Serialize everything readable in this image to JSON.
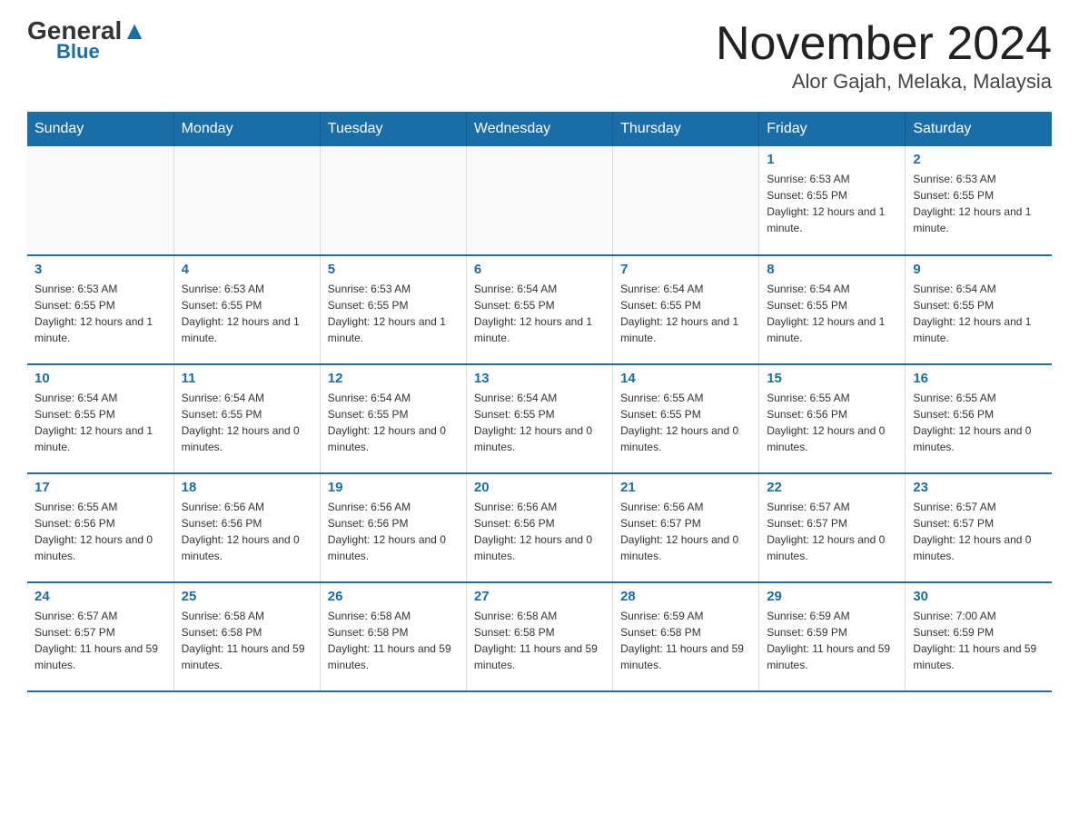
{
  "header": {
    "logo_general": "General",
    "logo_blue": "Blue",
    "month_title": "November 2024",
    "location": "Alor Gajah, Melaka, Malaysia"
  },
  "days_of_week": [
    "Sunday",
    "Monday",
    "Tuesday",
    "Wednesday",
    "Thursday",
    "Friday",
    "Saturday"
  ],
  "weeks": [
    [
      {
        "day": "",
        "info": ""
      },
      {
        "day": "",
        "info": ""
      },
      {
        "day": "",
        "info": ""
      },
      {
        "day": "",
        "info": ""
      },
      {
        "day": "",
        "info": ""
      },
      {
        "day": "1",
        "info": "Sunrise: 6:53 AM\nSunset: 6:55 PM\nDaylight: 12 hours and 1 minute."
      },
      {
        "day": "2",
        "info": "Sunrise: 6:53 AM\nSunset: 6:55 PM\nDaylight: 12 hours and 1 minute."
      }
    ],
    [
      {
        "day": "3",
        "info": "Sunrise: 6:53 AM\nSunset: 6:55 PM\nDaylight: 12 hours and 1 minute."
      },
      {
        "day": "4",
        "info": "Sunrise: 6:53 AM\nSunset: 6:55 PM\nDaylight: 12 hours and 1 minute."
      },
      {
        "day": "5",
        "info": "Sunrise: 6:53 AM\nSunset: 6:55 PM\nDaylight: 12 hours and 1 minute."
      },
      {
        "day": "6",
        "info": "Sunrise: 6:54 AM\nSunset: 6:55 PM\nDaylight: 12 hours and 1 minute."
      },
      {
        "day": "7",
        "info": "Sunrise: 6:54 AM\nSunset: 6:55 PM\nDaylight: 12 hours and 1 minute."
      },
      {
        "day": "8",
        "info": "Sunrise: 6:54 AM\nSunset: 6:55 PM\nDaylight: 12 hours and 1 minute."
      },
      {
        "day": "9",
        "info": "Sunrise: 6:54 AM\nSunset: 6:55 PM\nDaylight: 12 hours and 1 minute."
      }
    ],
    [
      {
        "day": "10",
        "info": "Sunrise: 6:54 AM\nSunset: 6:55 PM\nDaylight: 12 hours and 1 minute."
      },
      {
        "day": "11",
        "info": "Sunrise: 6:54 AM\nSunset: 6:55 PM\nDaylight: 12 hours and 0 minutes."
      },
      {
        "day": "12",
        "info": "Sunrise: 6:54 AM\nSunset: 6:55 PM\nDaylight: 12 hours and 0 minutes."
      },
      {
        "day": "13",
        "info": "Sunrise: 6:54 AM\nSunset: 6:55 PM\nDaylight: 12 hours and 0 minutes."
      },
      {
        "day": "14",
        "info": "Sunrise: 6:55 AM\nSunset: 6:55 PM\nDaylight: 12 hours and 0 minutes."
      },
      {
        "day": "15",
        "info": "Sunrise: 6:55 AM\nSunset: 6:56 PM\nDaylight: 12 hours and 0 minutes."
      },
      {
        "day": "16",
        "info": "Sunrise: 6:55 AM\nSunset: 6:56 PM\nDaylight: 12 hours and 0 minutes."
      }
    ],
    [
      {
        "day": "17",
        "info": "Sunrise: 6:55 AM\nSunset: 6:56 PM\nDaylight: 12 hours and 0 minutes."
      },
      {
        "day": "18",
        "info": "Sunrise: 6:56 AM\nSunset: 6:56 PM\nDaylight: 12 hours and 0 minutes."
      },
      {
        "day": "19",
        "info": "Sunrise: 6:56 AM\nSunset: 6:56 PM\nDaylight: 12 hours and 0 minutes."
      },
      {
        "day": "20",
        "info": "Sunrise: 6:56 AM\nSunset: 6:56 PM\nDaylight: 12 hours and 0 minutes."
      },
      {
        "day": "21",
        "info": "Sunrise: 6:56 AM\nSunset: 6:57 PM\nDaylight: 12 hours and 0 minutes."
      },
      {
        "day": "22",
        "info": "Sunrise: 6:57 AM\nSunset: 6:57 PM\nDaylight: 12 hours and 0 minutes."
      },
      {
        "day": "23",
        "info": "Sunrise: 6:57 AM\nSunset: 6:57 PM\nDaylight: 12 hours and 0 minutes."
      }
    ],
    [
      {
        "day": "24",
        "info": "Sunrise: 6:57 AM\nSunset: 6:57 PM\nDaylight: 11 hours and 59 minutes."
      },
      {
        "day": "25",
        "info": "Sunrise: 6:58 AM\nSunset: 6:58 PM\nDaylight: 11 hours and 59 minutes."
      },
      {
        "day": "26",
        "info": "Sunrise: 6:58 AM\nSunset: 6:58 PM\nDaylight: 11 hours and 59 minutes."
      },
      {
        "day": "27",
        "info": "Sunrise: 6:58 AM\nSunset: 6:58 PM\nDaylight: 11 hours and 59 minutes."
      },
      {
        "day": "28",
        "info": "Sunrise: 6:59 AM\nSunset: 6:58 PM\nDaylight: 11 hours and 59 minutes."
      },
      {
        "day": "29",
        "info": "Sunrise: 6:59 AM\nSunset: 6:59 PM\nDaylight: 11 hours and 59 minutes."
      },
      {
        "day": "30",
        "info": "Sunrise: 7:00 AM\nSunset: 6:59 PM\nDaylight: 11 hours and 59 minutes."
      }
    ]
  ]
}
